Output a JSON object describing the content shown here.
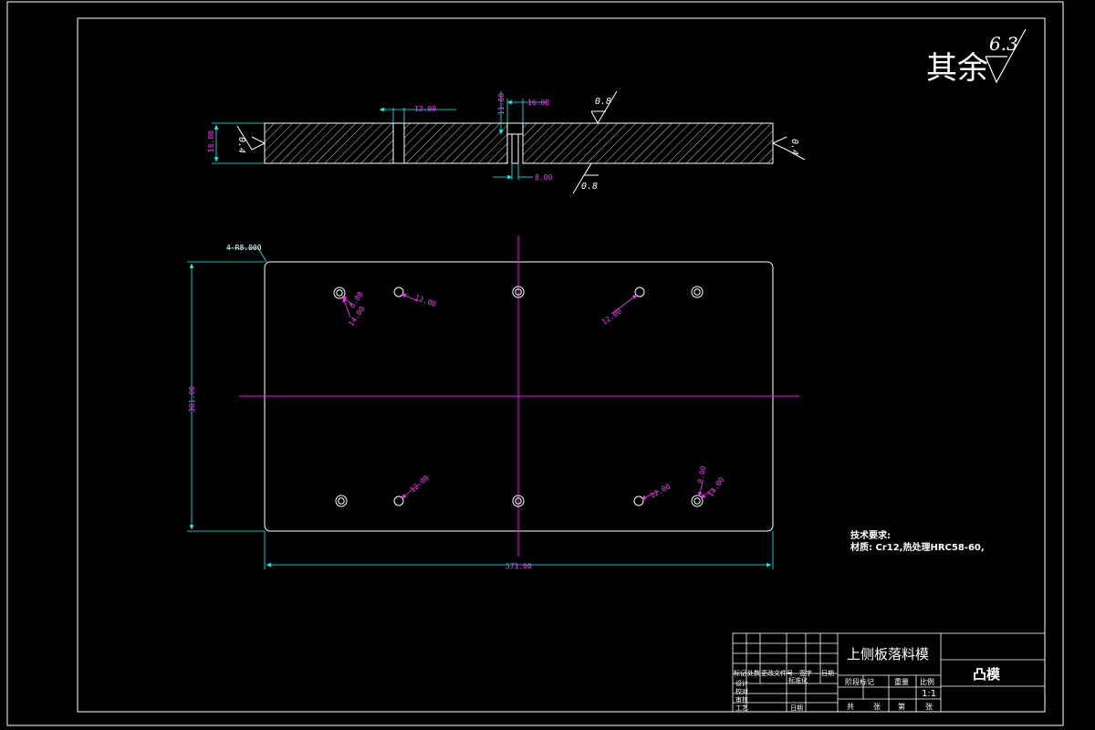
{
  "colors": {
    "background": "#000000",
    "outline": "#ffffff",
    "dimension": "#00ffff",
    "center_line": "#ff00ff",
    "hole_label": "#ff33ff",
    "hatch": "#ffffff"
  },
  "roughness": {
    "general_label": "其余",
    "general_value": "6.3",
    "face_top": "0.8",
    "face_bottom": "0.8",
    "face_left": "0.4",
    "face_right": "0.4"
  },
  "section_view": {
    "dim_thickness": "16.00",
    "dim_hole_left": "12.00",
    "dim_hole_top": "16.00",
    "dim_counterbore_depth": "11.60",
    "dim_hole_bottom": "8.00"
  },
  "plan_view": {
    "dim_corner": "4-R8.000",
    "dim_height": "301.00",
    "dim_width": "571.00",
    "hole_labels": [
      "8.00",
      "14.00",
      "12.00",
      "12.00",
      "12.00",
      "12.00",
      "8.00",
      "14.00"
    ]
  },
  "tech_requirements": {
    "title": "技术要求:",
    "material": "材质: Cr12,热处理HRC58-60,"
  },
  "title_block": {
    "part_name": "上侧板落料模",
    "drawing_name": "凸模",
    "scale": "1:1",
    "col_labels": [
      "标记",
      "处数",
      "更改文件号",
      "签字",
      "日期"
    ],
    "row_labels": [
      "设计",
      "校对",
      "审核",
      "工艺"
    ],
    "standard_label": "标准化",
    "date_label": "日期",
    "stage_label": "阶段标记",
    "weight_label": "重量",
    "scale_label": "比例",
    "sheet_total": "共",
    "sheet_unit": "张",
    "sheet_no": "第",
    "sheet_unit_2": "张"
  }
}
